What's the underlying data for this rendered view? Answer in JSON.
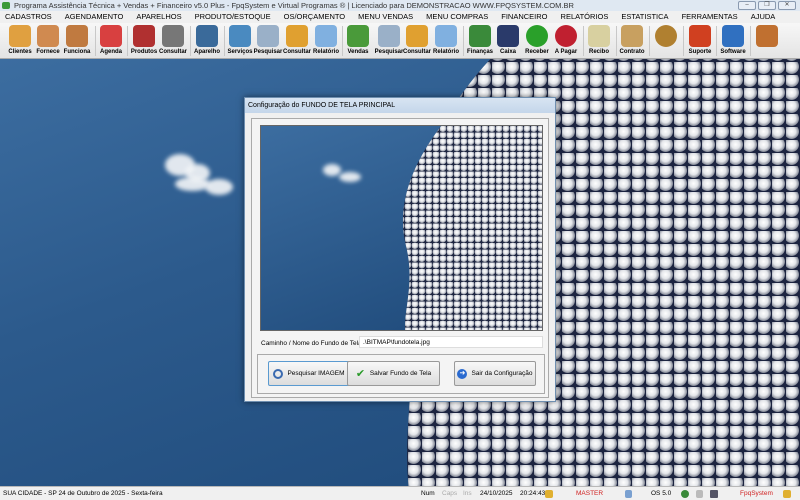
{
  "window": {
    "title": "Programa Assistência Técnica + Vendas + Financeiro v5.0 Plus - FpqSystem e Virtual Programas ® | Licenciado para  DEMONSTRACAO WWW.FPQSYSTEM.COM.BR",
    "min": "–",
    "max": "❐",
    "close": "✕"
  },
  "menu": [
    "CADASTROS",
    "AGENDAMENTO",
    "APARELHOS",
    "PRODUTO/ESTOQUE",
    "OS/ORÇAMENTO",
    "MENU VENDAS",
    "MENU COMPRAS",
    "FINANCEIRO",
    "RELATÓRIOS",
    "ESTATISTICA",
    "FERRAMENTAS",
    "AJUDA"
  ],
  "toolbar": [
    {
      "label": "Clientes",
      "icon": "users-icon",
      "color": "#e0a040"
    },
    {
      "label": "Fornece",
      "icon": "supplier-icon",
      "color": "#d08a50"
    },
    {
      "label": "Funciona",
      "icon": "employee-icon",
      "color": "#c07a40"
    },
    {
      "label": "Agenda",
      "icon": "calendar-icon",
      "color": "#d84040"
    },
    {
      "label": "Produtos",
      "icon": "products-icon",
      "color": "#b03030"
    },
    {
      "label": "Consultar",
      "icon": "barcode-icon",
      "color": "#777777"
    },
    {
      "label": "Aparelho",
      "icon": "device-icon",
      "color": "#3a6a9a"
    },
    {
      "label": "Serviços",
      "icon": "services-icon",
      "color": "#4a8ac0"
    },
    {
      "label": "Pesquisar",
      "icon": "search-doc-icon",
      "color": "#9ab0c8"
    },
    {
      "label": "Consultar",
      "icon": "folder-icon",
      "color": "#e0a030"
    },
    {
      "label": "Relatório",
      "icon": "printer-icon",
      "color": "#80b0e0"
    },
    {
      "label": "Vendas",
      "icon": "cart-icon",
      "color": "#4a9a3a"
    },
    {
      "label": "Pesquisar",
      "icon": "search-doc-icon",
      "color": "#9ab0c8"
    },
    {
      "label": "Consultar",
      "icon": "folder-icon",
      "color": "#e0a030"
    },
    {
      "label": "Relatório",
      "icon": "printer-icon",
      "color": "#80b0e0"
    },
    {
      "label": "Finanças",
      "icon": "finance-icon",
      "color": "#3a8a3a"
    },
    {
      "label": "Caixa",
      "icon": "cashbook-icon",
      "color": "#2a3a6a"
    },
    {
      "label": "Receber",
      "icon": "receive-icon",
      "color": "#2aa02a"
    },
    {
      "label": "A Pagar",
      "icon": "pay-icon",
      "color": "#c02030"
    },
    {
      "label": "Recibo",
      "icon": "receipt-icon",
      "color": "#d8d0a0"
    },
    {
      "label": "Contrato",
      "icon": "contract-icon",
      "color": "#c8a060"
    },
    {
      "label": "",
      "icon": "coin-icon",
      "color": "#b08030"
    },
    {
      "label": "Suporte",
      "icon": "support-icon",
      "color": "#d04020"
    },
    {
      "label": "Software",
      "icon": "software-icon",
      "color": "#3070c0"
    },
    {
      "label": "",
      "icon": "exit-icon",
      "color": "#c07030"
    }
  ],
  "dialog": {
    "title": "Configuração do FUNDO DE TELA PRINCIPAL",
    "path_label": "Caminho / Nome do Fundo de Tela",
    "path_value": ".\\BITMAP\\fundotela.jpg",
    "btn_search": "Pesquisar IMAGEM",
    "btn_save": "Salvar Fundo de Tela",
    "btn_exit": "Sair da Configuração"
  },
  "status": {
    "city": "SUA CIDADE - SP 24 de Outubro de 2025 - Sexta-feira",
    "num": "Num",
    "caps": "Caps",
    "ins": "Ins",
    "date": "24/10/2025",
    "time": "20:24:43",
    "user": "MASTER",
    "os": "OS 5.0",
    "brand": "FpqSystem",
    "accent": "#d02020"
  }
}
